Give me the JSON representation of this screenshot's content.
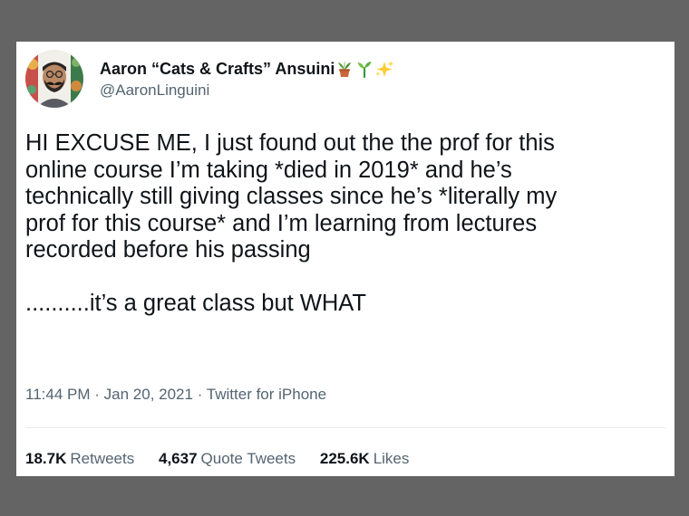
{
  "tweet": {
    "display_name": "Aaron “Cats & Crafts” Ansuini",
    "name_emojis": [
      "potted-plant-icon",
      "seedling-icon",
      "sparkles-icon"
    ],
    "handle": "@AaronLinguini",
    "text_lines": [
      "HI EXCUSE ME, I just found out the the prof for this",
      "online course I’m taking *died in 2019* and he’s",
      "technically still giving classes since he’s *literally my",
      "prof for this course* and I’m learning from lectures",
      "recorded before his passing"
    ],
    "text_last": "..........it’s a great class but WHAT",
    "time": "11:44 PM",
    "sep1": "·",
    "date": "Jan 20, 2021",
    "sep2": "·",
    "client": "Twitter for iPhone"
  },
  "stats": {
    "retweets_count": "18.7K",
    "retweets_label": "Retweets",
    "quotes_count": "4,637",
    "quotes_label": "Quote Tweets",
    "likes_count": "225.6K",
    "likes_label": "Likes"
  },
  "colors": {
    "page_background": "#646464",
    "card_background": "#ffffff",
    "text_primary": "#0f1419",
    "text_secondary": "#536471"
  }
}
